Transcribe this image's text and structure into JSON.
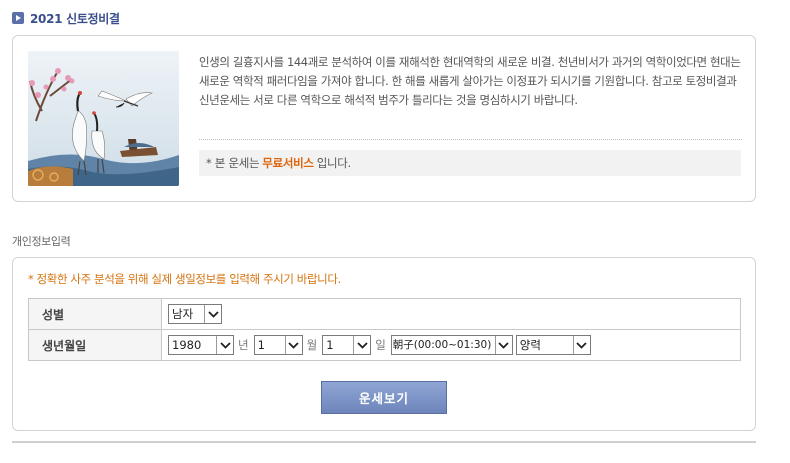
{
  "page": {
    "title": "2021 신토정비결"
  },
  "intro": {
    "description": "인생의 길흉지사를 144괘로 분석하여 이를 재해석한 현대역학의 새로운 비결. 천년비서가 과거의 역학이었다면 현대는 새로운 역학적 패러다임을 가져야 합니다. 한 해를 새롭게 살아가는 이정표가 되시기를 기원합니다. 참고로 토정비결과 신년운세는 서로 다른 역학으로 해석적 범주가 틀리다는 것을 명심하시기 바랍니다.",
    "notice_prefix": "* 본 운세는",
    "notice_highlight": "무료서비스",
    "notice_suffix": "입니다."
  },
  "form": {
    "section_label": "개인정보입력",
    "notice": "* 정확한 사주 분석을 위해 실제 생일정보를 입력해 주시기 바랍니다.",
    "gender_label": "성별",
    "gender_value": "남자",
    "birth_label": "생년월일",
    "year_value": "1980",
    "year_unit": "년",
    "month_value": "1",
    "month_unit": "월",
    "day_value": "1",
    "day_unit": "일",
    "hour_value": "朝子(00:00~01:30)",
    "calendar_value": "양력",
    "submit_label": "운세보기"
  },
  "colors": {
    "title": "#3a4e8c",
    "highlight": "#e0640b",
    "form_notice": "#d5730f",
    "button": "#7a92c6"
  },
  "icons": {
    "title_marker": "play-square-icon",
    "select_arrow": "chevron-down-icon"
  }
}
